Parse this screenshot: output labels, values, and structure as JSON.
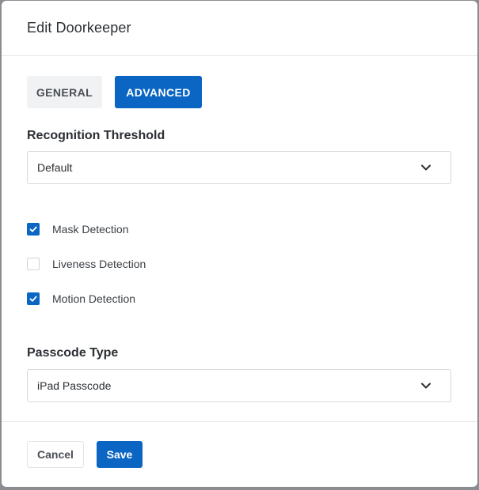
{
  "modal": {
    "title": "Edit Doorkeeper"
  },
  "tabs": [
    {
      "label": "GENERAL",
      "active": false
    },
    {
      "label": "ADVANCED",
      "active": true
    }
  ],
  "recognition": {
    "label": "Recognition Threshold",
    "selected": "Default"
  },
  "detections": [
    {
      "label": "Mask Detection",
      "checked": true
    },
    {
      "label": "Liveness Detection",
      "checked": false
    },
    {
      "label": "Motion Detection",
      "checked": true
    }
  ],
  "passcode": {
    "label": "Passcode Type",
    "selected": "iPad Passcode"
  },
  "footer": {
    "cancel_label": "Cancel",
    "save_label": "Save"
  },
  "colors": {
    "accent": "#0a66c2",
    "backdrop": "#8a8d91"
  },
  "icons": {
    "select_arrow": "chevron-down-icon",
    "checkbox_mark": "checkmark-icon"
  }
}
